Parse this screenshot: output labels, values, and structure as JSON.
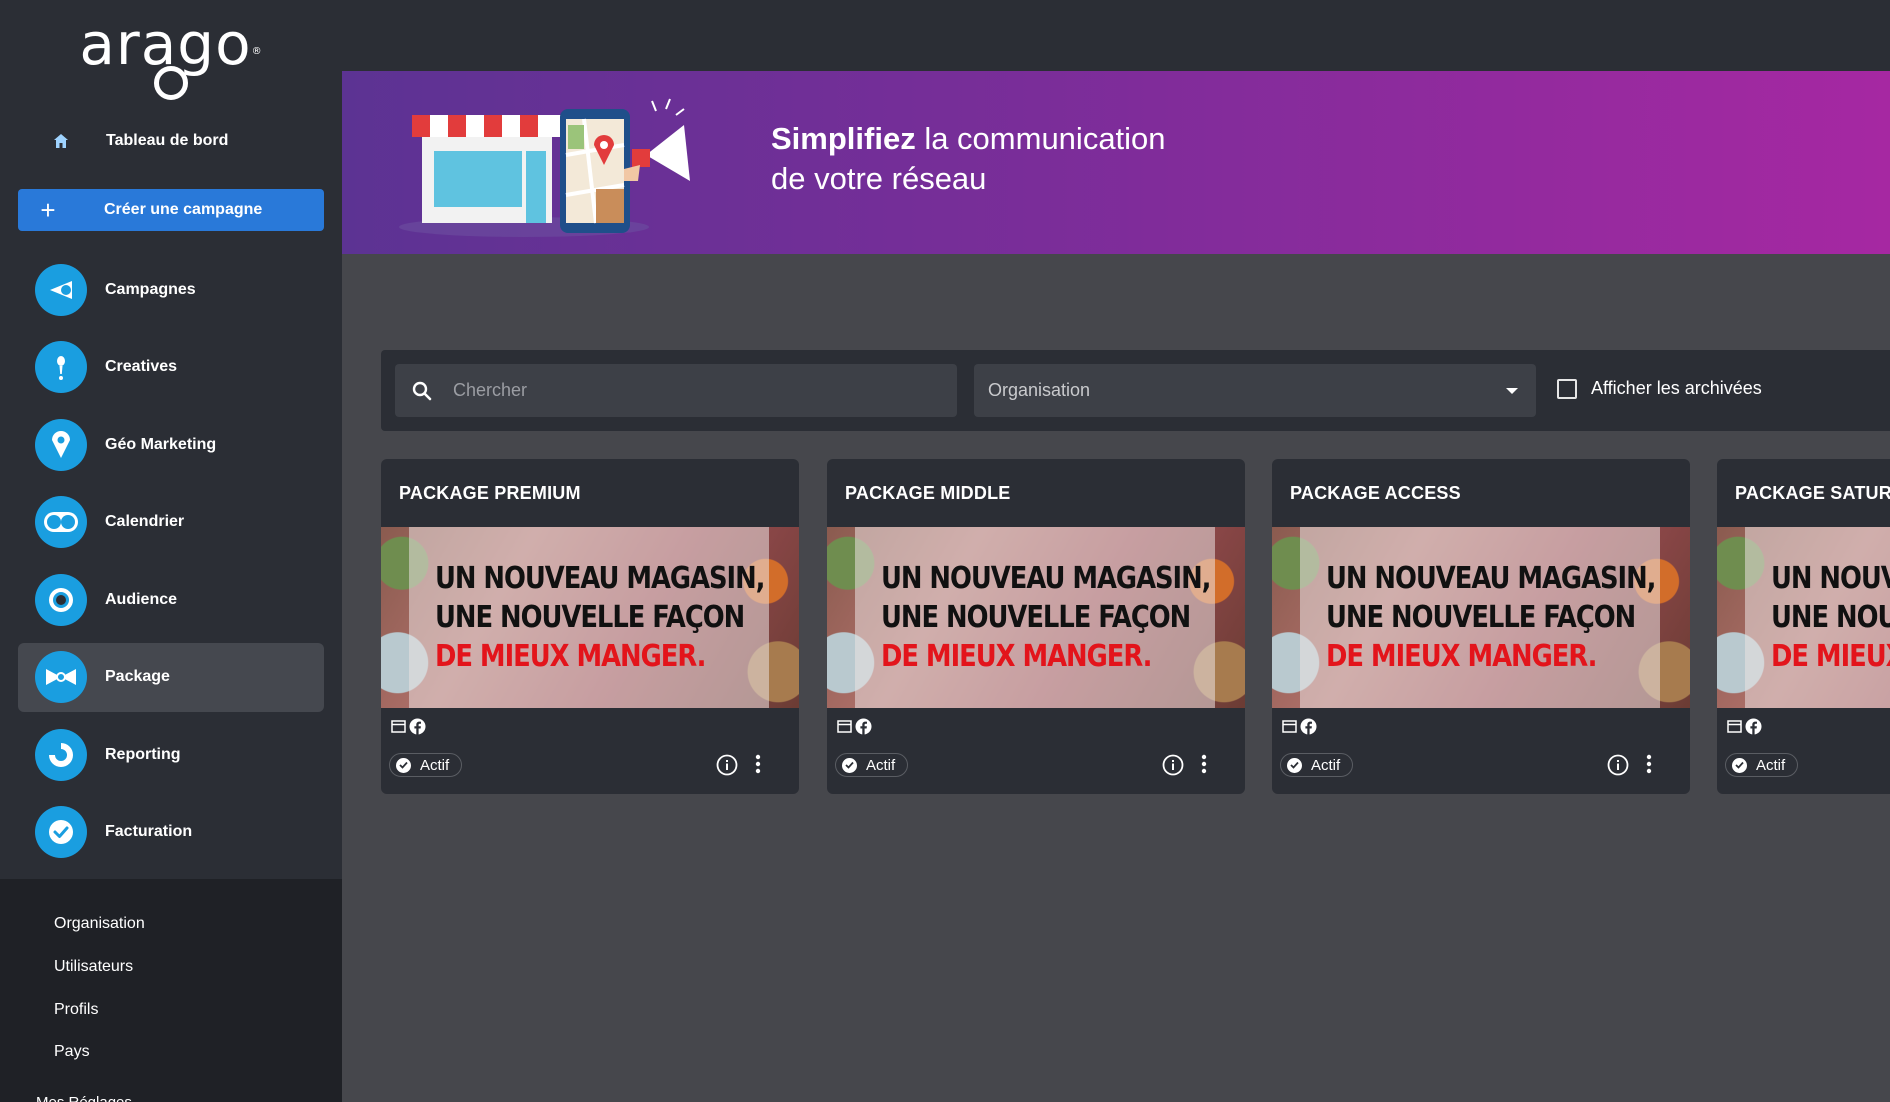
{
  "app": {
    "logo_text": "arago",
    "logo_mark": "®"
  },
  "sidebar": {
    "home_label": "Tableau de bord",
    "create_label": "Créer une campagne",
    "items": [
      {
        "label": "Campagnes",
        "icon": "megaphone-icon"
      },
      {
        "label": "Creatives",
        "icon": "lightbulb-icon"
      },
      {
        "label": "Géo Marketing",
        "icon": "map-pin-icon"
      },
      {
        "label": "Calendrier",
        "icon": "toggle-icon"
      },
      {
        "label": "Audience",
        "icon": "target-icon"
      },
      {
        "label": "Package",
        "icon": "bowtie-icon",
        "active": true
      },
      {
        "label": "Reporting",
        "icon": "donut-chart-icon"
      },
      {
        "label": "Facturation",
        "icon": "check-badge-icon"
      }
    ],
    "admin": [
      "Organisation",
      "Utilisateurs",
      "Profils",
      "Pays"
    ],
    "admin_cut_label": "Mes Réglages"
  },
  "banner": {
    "bold": "Simplifiez",
    "line1_rest": " la communication",
    "line2": "de votre réseau"
  },
  "filters": {
    "search_placeholder": "Chercher",
    "organisation_value": "Organisation",
    "archive_label": "Afficher les archivées"
  },
  "cards": [
    {
      "title": "PACKAGE PREMIUM",
      "status": "Actif"
    },
    {
      "title": "PACKAGE MIDDLE",
      "status": "Actif"
    },
    {
      "title": "PACKAGE ACCESS",
      "status": "Actif"
    },
    {
      "title": "PACKAGE SATURA",
      "status": "Actif"
    }
  ],
  "creative_text": {
    "line1": "UN NOUVEAU MAGASIN,",
    "line2": "UNE NOUVELLE FAÇON",
    "line3": "DE MIEUX MANGER."
  },
  "colors": {
    "accent": "#2979d9",
    "icon_blue": "#1a9ee0",
    "sidebar": "#2b2e35",
    "content": "#46474c",
    "promo_red": "#e3141b"
  }
}
